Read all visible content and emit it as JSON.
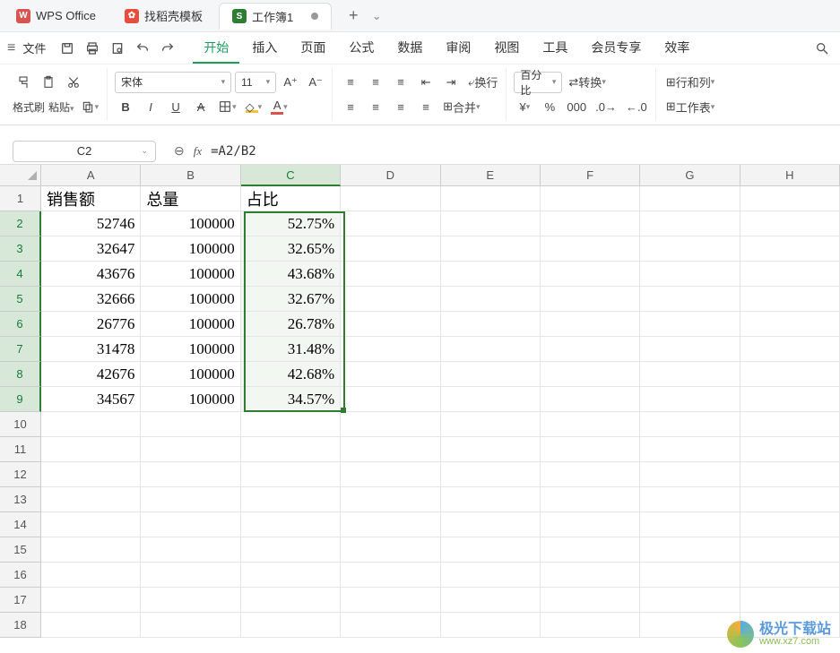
{
  "titlebar": {
    "app_name": "WPS Office",
    "template_tab": "找稻壳模板",
    "workbook_tab": "工作簿1",
    "add": "+",
    "menu": "⌄"
  },
  "menubar": {
    "file": "文件",
    "tabs": [
      "开始",
      "插入",
      "页面",
      "公式",
      "数据",
      "审阅",
      "视图",
      "工具",
      "会员专享",
      "效率"
    ],
    "active_index": 0
  },
  "ribbon": {
    "paintbrush": "格式刷",
    "paste": "粘贴",
    "font_name": "宋体",
    "font_size": "11",
    "wrap": "换行",
    "merge": "合并",
    "zoom": "百分比",
    "convert": "转换",
    "rowscols": "行和列",
    "worksheet": "工作表",
    "currency": "¥"
  },
  "formula": {
    "cell_ref": "C2",
    "formula_text": "=A2/B2",
    "fx": "fx"
  },
  "columns": [
    "A",
    "B",
    "C",
    "D",
    "E",
    "F",
    "G",
    "H"
  ],
  "selected_col_index": 2,
  "row_count": 18,
  "selected_rows": [
    2,
    3,
    4,
    5,
    6,
    7,
    8,
    9
  ],
  "headers": {
    "A": "销售额",
    "B": "总量",
    "C": "占比"
  },
  "data_rows": [
    {
      "A": "52746",
      "B": "100000",
      "C": "52.75%"
    },
    {
      "A": "32647",
      "B": "100000",
      "C": "32.65%"
    },
    {
      "A": "43676",
      "B": "100000",
      "C": "43.68%"
    },
    {
      "A": "32666",
      "B": "100000",
      "C": "32.67%"
    },
    {
      "A": "26776",
      "B": "100000",
      "C": "26.78%"
    },
    {
      "A": "31478",
      "B": "100000",
      "C": "31.48%"
    },
    {
      "A": "42676",
      "B": "100000",
      "C": "42.68%"
    },
    {
      "A": "34567",
      "B": "100000",
      "C": "34.57%"
    }
  ],
  "watermark": {
    "name": "极光下载站",
    "url": "www.xz7.com"
  }
}
